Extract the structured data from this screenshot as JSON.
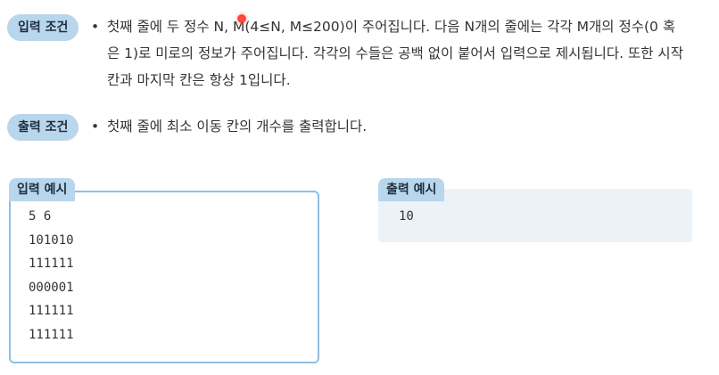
{
  "input_condition": {
    "badge": "입력 조건",
    "bullet": "•",
    "lines": [
      "첫째 줄에 두 정수 N, M(4≤N, M≤200)이 주어집니다. 다음 N개의 줄에는 각각 M개의 정수(0 혹",
      "은 1)로 미로의 정보가 주어집니다. 각각의 수들은 공백 없이 붙어서 입력으로 제시됩니다. 또한 시작",
      "칸과 마지막 칸은 항상 1입니다."
    ]
  },
  "output_condition": {
    "badge": "출력 조건",
    "bullet": "•",
    "lines": [
      "첫째 줄에 최소 이동 칸의 개수를 출력합니다."
    ]
  },
  "input_example": {
    "label": "입력 예시",
    "rows": [
      "5 6",
      "101010",
      "111111",
      "000001",
      "111111",
      "111111"
    ]
  },
  "output_example": {
    "label": "출력 예시",
    "rows": [
      "10"
    ]
  }
}
